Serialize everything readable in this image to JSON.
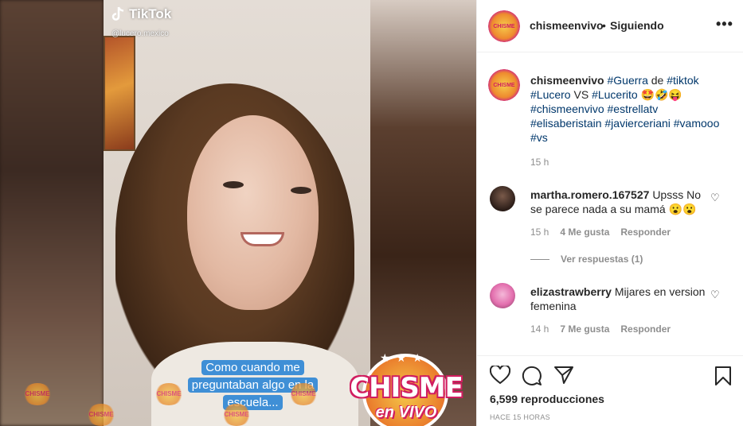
{
  "video": {
    "tiktok_brand": "TikTok",
    "tiktok_handle": "@lucero.mexico",
    "caption": "Como cuando me preguntaban algo en la escuela...",
    "logo_word1": "CHISME",
    "logo_word2": "en VIVO",
    "watermark_text": "CHISME"
  },
  "header": {
    "username": "chismeenvivo",
    "separator": "•",
    "follow_status": "Siguiendo",
    "more_icon": "more-horizontal-icon"
  },
  "post": {
    "username": "chismeenvivo",
    "caption_parts": [
      "#Guerra",
      "de",
      "#tiktok",
      "#Lucero",
      "VS",
      "#Lucerito",
      "🤩🤣😝",
      "#chismeenvivo",
      "#estrellatv",
      "#elisaberistain",
      "#javierceriani",
      "#vamooo",
      "#vs"
    ],
    "time": "15 h"
  },
  "comments": [
    {
      "username": "martha.romero.167527",
      "text": "Upsss No se parece nada a su mamá 😮😮",
      "time": "15 h",
      "likes": "4 Me gusta",
      "reply_label": "Responder",
      "view_replies": "Ver respuestas (1)"
    },
    {
      "username": "elizastrawberry",
      "text": "Mijares en version femenina",
      "time": "14 h",
      "likes": "7 Me gusta",
      "reply_label": "Responder"
    }
  ],
  "actions": {
    "views": "6,599 reproducciones",
    "time_ago": "HACE 15 HORAS"
  },
  "colors": {
    "hashtag": "#00376b",
    "meta": "#8e8e8e",
    "caption_bg": "#3f8fd6",
    "brand_pink": "#d11d60"
  }
}
